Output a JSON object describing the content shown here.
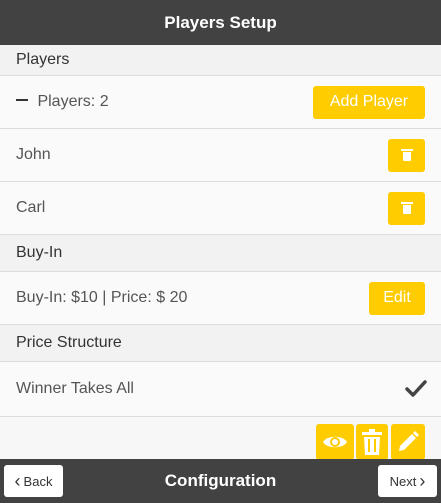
{
  "header": {
    "title": "Players Setup"
  },
  "sections": {
    "players": {
      "title": "Players"
    },
    "buyin": {
      "title": "Buy-In"
    },
    "price_structure": {
      "title": "Price Structure"
    }
  },
  "players": {
    "count_label": "Players: 2",
    "add_button": "Add Player",
    "list": [
      {
        "name": "John",
        "delete_icon": "trash-icon"
      },
      {
        "name": "Carl",
        "delete_icon": "trash-icon"
      }
    ]
  },
  "buyin": {
    "text": "Buy-In: $10 | Price: $ 20",
    "edit_button": "Edit"
  },
  "price_structure": {
    "option": "Winner Takes All",
    "selected_icon": "checkmark-icon"
  },
  "actions": {
    "icons": [
      "eye-icon",
      "trash-icon",
      "pencil-icon"
    ]
  },
  "footer": {
    "back": "Back",
    "title": "Configuration",
    "next": "Next"
  },
  "colors": {
    "accent": "#ffcc00",
    "bar": "#424242",
    "background": "#f7f7f7"
  }
}
